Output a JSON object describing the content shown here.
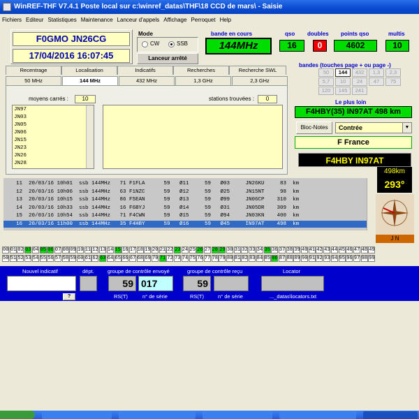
{
  "window": {
    "title": "WinREF-THF V7.4.1 Poste local sur c:\\winref_datas\\THF\\18 CCD de mars\\ -  Saisie"
  },
  "menu": [
    "Fichiers",
    "Editeur",
    "Statistiques",
    "Maintenance",
    "Lanceur d'appels",
    "Affichage",
    "Perroquet",
    "Help"
  ],
  "station": {
    "callsign": "F0GMO  JN26CG",
    "datetime": "17/04/2016   16:07:45"
  },
  "mode": {
    "label": "Mode",
    "options": [
      "CW",
      "SSB"
    ],
    "selected": "SSB",
    "launcher": "Lanceur arrêté"
  },
  "stats": {
    "band_label": "bande en cours",
    "band": "144MHz",
    "qso_label": "qso",
    "qso": "16",
    "doubles_label": "doubles",
    "doubles": "0",
    "points_label": "points qso",
    "points": "4602",
    "multis_label": "multis",
    "multis": "10"
  },
  "bands": {
    "title": "bandes (touches page + ou page -)",
    "rows": [
      [
        "50",
        "144",
        "432",
        "1,3",
        "2,3"
      ],
      [
        "5,7",
        "10",
        "24",
        "47",
        "75"
      ],
      [
        "120",
        "145",
        "241"
      ]
    ],
    "selected": "144"
  },
  "tabs_row1": [
    "Recentrage",
    "Localisation",
    "Indicatifs",
    "Recherches",
    "Recherche SWL"
  ],
  "tabs_row2": [
    "50 MHz",
    "144 MHz",
    "432 MHz",
    "1,3 GHz",
    "2,3 GHz"
  ],
  "active_tab2": "144 MHz",
  "squares": {
    "label": "moyens carrés :",
    "count": "10",
    "list": [
      "JN97",
      "JN03",
      "JN05",
      "JN06",
      "JN15",
      "JN23",
      "JN26",
      "JN28"
    ]
  },
  "stations": {
    "label": "stations trouvées :",
    "count": "0"
  },
  "farthest": {
    "label": "Le plus loin",
    "value": "F4HBY(35) IN97AT  498 km"
  },
  "notes": {
    "button": "Bloc-Notes",
    "select": "Contrée"
  },
  "country": "F      France",
  "current": {
    "call": "F4HBY   IN97AT",
    "distance": "498km",
    "azimuth": "293°",
    "compass_label": "J N"
  },
  "log": [
    "11  20/03/16 10h01  ssb 144MHz   71 F1FLA      59   Ø11     59   Ø03     JN26KU     83  km",
    "12  20/03/16 10h06  ssb 144MHz   63 F1NZC      59   Ø12     59   Ø25     JN15NT     98  km",
    "13  20/03/16 10h15  ssb 144MHz   86 F5EAN      59   Ø13     59   Ø99     JN06CP    310  km",
    "14  20/03/16 10h33  ssb 144MHz   16 F6BYJ      59   Ø14     59   Ø31     JN05DR    309  km",
    "15  20/03/16 10h54  ssb 144MHz   71 F4CWN      59   Ø15     59   Ø94     JN03KN    400  km",
    "16  20/03/16 11h00  ssb 144MHz   35 F4HBY      59   Ø16     59   Ø45     IN97AT    498  km"
  ],
  "log_selected": 5,
  "dept_grid": {
    "row1": [
      "00",
      "01",
      "02",
      "03",
      "04",
      "05",
      "06",
      "07",
      "08",
      "09",
      "10",
      "11",
      "12",
      "13",
      "14",
      "15",
      "16",
      "17",
      "18",
      "19",
      "20",
      "21",
      "22",
      "23",
      "24",
      "25",
      "26",
      "27",
      "28",
      "29",
      "30",
      "31",
      "32",
      "33",
      "34",
      "35",
      "36",
      "37",
      "38",
      "39",
      "40",
      "41",
      "42",
      "43",
      "44",
      "45",
      "46",
      "47",
      "48",
      "49"
    ],
    "row2": [
      "50",
      "51",
      "52",
      "53",
      "54",
      "55",
      "56",
      "57",
      "58",
      "59",
      "60",
      "61",
      "62",
      "63",
      "64",
      "65",
      "66",
      "67",
      "68",
      "69",
      "70",
      "71",
      "72",
      "73",
      "74",
      "75",
      "76",
      "77",
      "78",
      "79",
      "80",
      "81",
      "82",
      "83",
      "84",
      "85",
      "86",
      "87",
      "88",
      "89",
      "90",
      "91",
      "92",
      "93",
      "94",
      "95",
      "96",
      "97",
      "98",
      "99"
    ],
    "green": [
      "03",
      "05",
      "06",
      "15",
      "23",
      "26",
      "28",
      "29",
      "35",
      "63",
      "71",
      "86"
    ]
  },
  "entry": {
    "new_call": "Nouvel indicatif",
    "dept": "dépt.",
    "help": "?",
    "sent_group": "groupe de contrôle envoyé",
    "sent_rst": "59",
    "sent_serial": "017",
    "rst_label": "RS(T)",
    "serial_label": "n° de série",
    "recv_group": "groupe de contrôle reçu",
    "recv_rst": "59",
    "locator_label": "Locator",
    "locator_file": "..._datas\\locators.txt"
  }
}
